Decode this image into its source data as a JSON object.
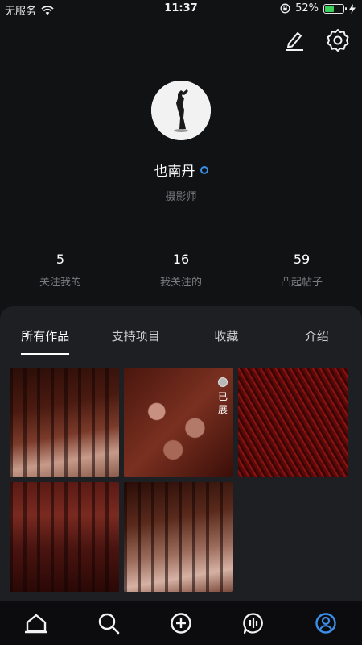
{
  "status_bar": {
    "carrier": "无服务",
    "time": "11:37",
    "battery_percent": "52%",
    "battery_level": 0.52,
    "icons": [
      "wifi-icon",
      "rotation-lock-icon",
      "battery-icon",
      "charging-icon"
    ]
  },
  "top_actions": {
    "icons": [
      "edit-icon",
      "settings-icon"
    ]
  },
  "profile": {
    "name": "也南丹",
    "role": "摄影师"
  },
  "stats": [
    {
      "value": "5",
      "label": "关注我的"
    },
    {
      "value": "16",
      "label": "我关注的"
    },
    {
      "value": "59",
      "label": "凸起帖子"
    }
  ],
  "tabs": [
    "所有作品",
    "支持项目",
    "收藏",
    "介绍"
  ],
  "active_tab": "所有作品",
  "gallery": {
    "badge_text": "已展"
  },
  "bottom_nav": {
    "items": [
      "home-icon",
      "search-icon",
      "add-icon",
      "messages-icon",
      "profile-icon"
    ],
    "active": "profile-icon",
    "active_color": "#3b8fe8"
  },
  "colors": {
    "accent": "#3b8fe8",
    "background": "#111214",
    "panel": "#1e1f23"
  }
}
